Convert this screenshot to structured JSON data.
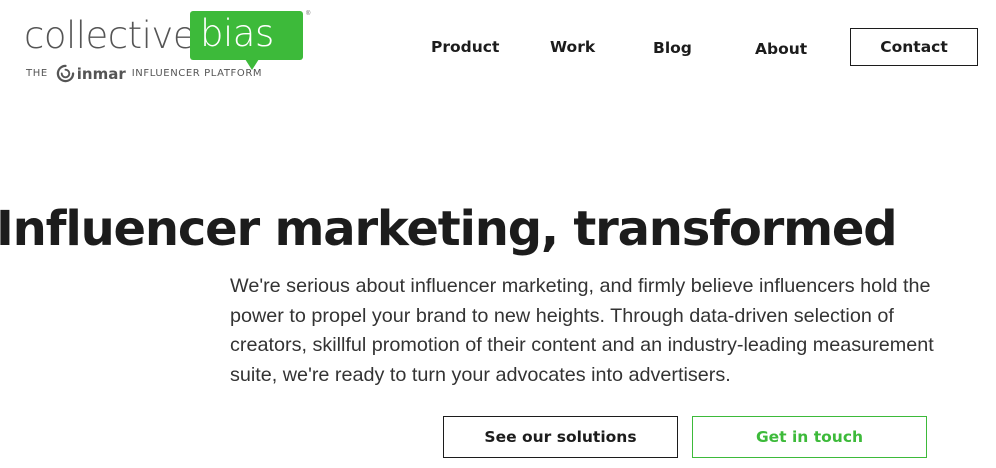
{
  "brand": {
    "word": "collective",
    "bubble_word": "bias",
    "registered": "®",
    "tagline_the": "THE",
    "tagline_inmar": "inmar",
    "tagline_rest": "INFLUENCER PLATFORM",
    "green": "#3dba3a",
    "icon": "inmar-logo-mark"
  },
  "nav": {
    "items": [
      {
        "label": "Product"
      },
      {
        "label": "Work"
      },
      {
        "label": "Blog"
      },
      {
        "label": "About"
      }
    ],
    "contact_label": "Contact"
  },
  "hero": {
    "title": "Influencer marketing, transformed",
    "body": "We're serious about influencer marketing, and firmly believe influencers hold the power to propel your brand to new heights. Through data-driven selection of creators, skillful promotion of their content and an industry-leading measurement suite, we're ready to turn your advocates into advertisers.",
    "primary_cta": "See our solutions",
    "secondary_cta": "Get in touch"
  },
  "colors": {
    "text": "#1c1c1c",
    "body_text": "#333333",
    "accent": "#3dba3a"
  }
}
